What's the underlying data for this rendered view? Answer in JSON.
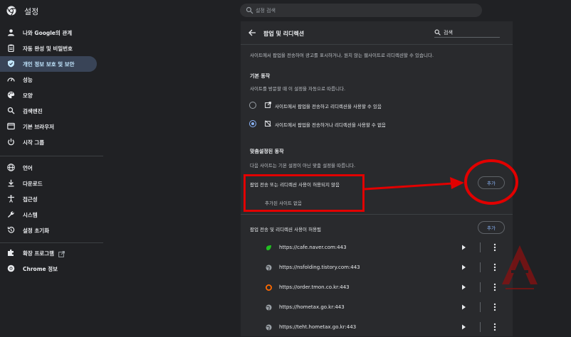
{
  "app": {
    "title": "설정"
  },
  "search": {
    "placeholder": "설정 검색"
  },
  "sidebar": {
    "items": [
      {
        "label": "나와 Google의 관계",
        "icon": "person-icon"
      },
      {
        "label": "자동 완성 및 비밀번호",
        "icon": "clipboard-icon"
      },
      {
        "label": "개인 정보 보호 및 보안",
        "icon": "shield-icon",
        "active": true
      },
      {
        "label": "성능",
        "icon": "speedometer-icon"
      },
      {
        "label": "모양",
        "icon": "palette-icon"
      },
      {
        "label": "검색엔진",
        "icon": "search-icon"
      },
      {
        "label": "기본 브라우저",
        "icon": "browser-icon"
      },
      {
        "label": "시작 그룹",
        "icon": "power-icon"
      },
      {
        "label": "언어",
        "icon": "globe-icon"
      },
      {
        "label": "다운로드",
        "icon": "download-icon"
      },
      {
        "label": "접근성",
        "icon": "accessibility-icon"
      },
      {
        "label": "시스템",
        "icon": "wrench-icon"
      },
      {
        "label": "설정 초기화",
        "icon": "reset-icon"
      },
      {
        "label": "확장 프로그램",
        "icon": "puzzle-icon"
      },
      {
        "label": "Chrome 정보",
        "icon": "chrome-icon"
      }
    ]
  },
  "page": {
    "title": "팝업 및 리디렉션",
    "search_value": "검색",
    "description": "사이트에서 팝업을 전송하여 광고를 표시하거나, 원치 않는 웹사이트로 리디렉션할 수 있습니다.",
    "default_heading": "기본 동작",
    "default_sub": "사이트를 방문할 때 이 설정을 자동으로 따릅니다.",
    "option_allow": "사이트에서 팝업을 전송하고 리디렉션을 사용할 수 있음",
    "option_block": "사이트에서 팝업을 전송하거나 리디렉션을 사용할 수 없음",
    "custom_heading": "맞춤설정된 동작",
    "custom_sub": "다음 사이트는 기본 설정이 아닌 맞춤 설정을 따릅니다.",
    "blocked_heading": "팝업 전송 또는 리디렉션 사용이 허용되지 않음",
    "blocked_empty": "추가된 사이트 없음",
    "add_label": "추가",
    "allowed_heading": "팝업 전송 및 리디렉션 사용이 허용됨",
    "sites": [
      {
        "url": "https://cafe.naver.com:443",
        "icon": "naver-cafe-icon"
      },
      {
        "url": "https://nsfolding.tistory.com:443",
        "icon": "globe-icon"
      },
      {
        "url": "https://order.tmon.co.kr:443",
        "icon": "tmon-icon"
      },
      {
        "url": "https://hometax.go.kr:443",
        "icon": "globe-icon"
      },
      {
        "url": "https://teht.hometax.go.kr:443",
        "icon": "globe-icon"
      }
    ]
  },
  "colors": {
    "annotation": "#e10000",
    "accent": "#8ab4f8",
    "active_nav": "#394457"
  }
}
